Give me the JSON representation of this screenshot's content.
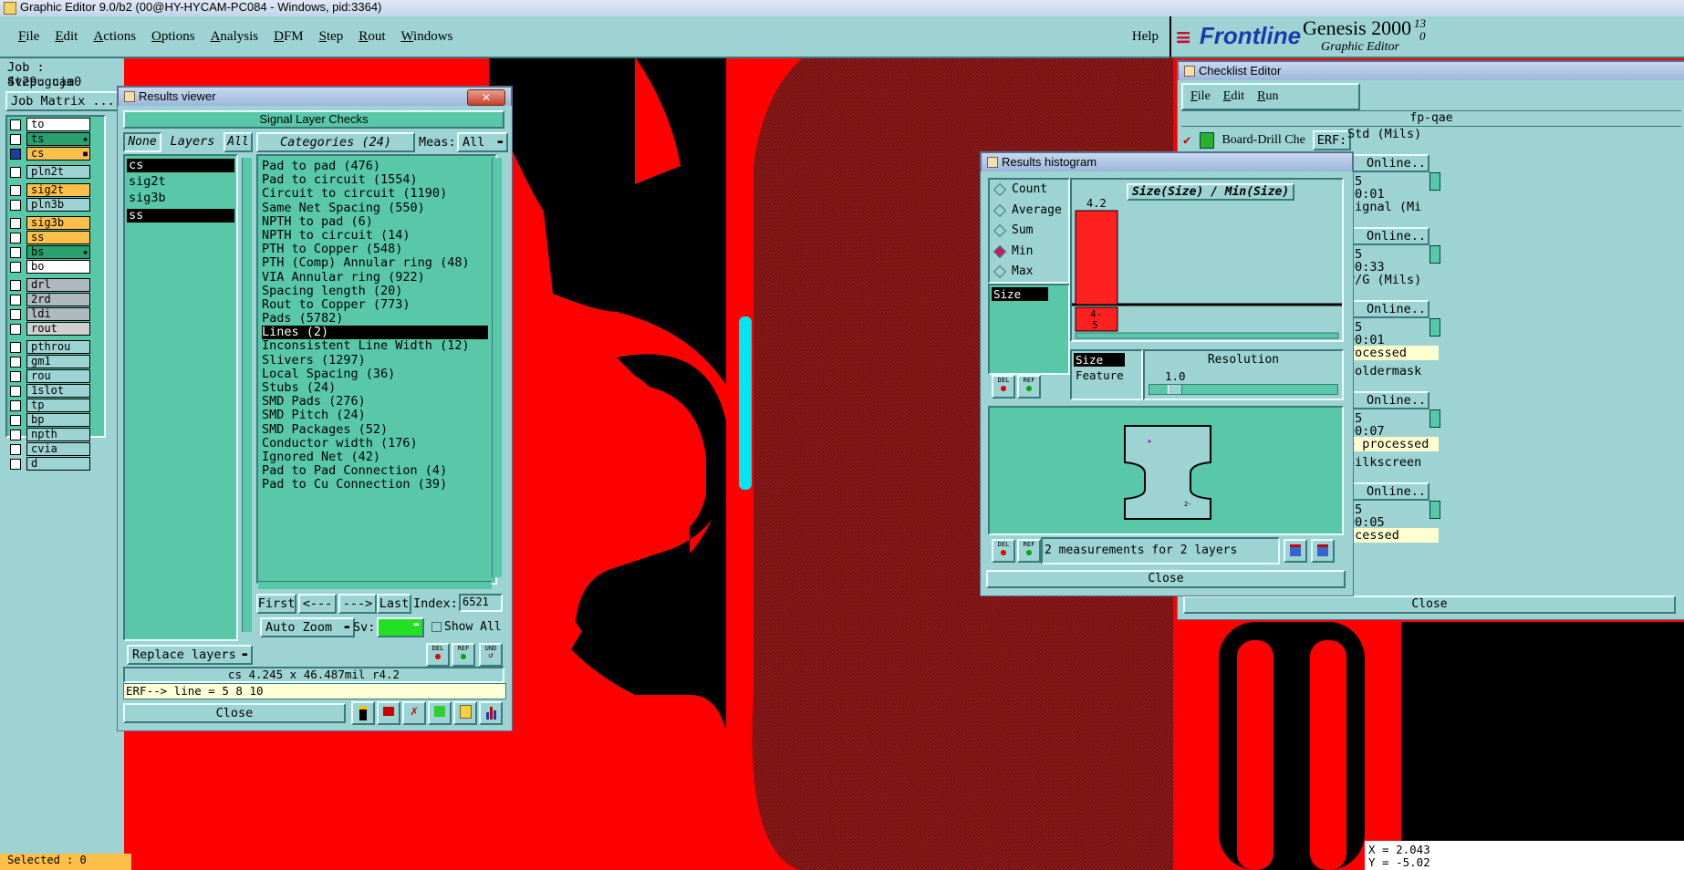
{
  "titlebar": {
    "title": "Graphic Editor 9.0/b2 (00@HY-HYCAM-PC084 - Windows, pid:3364)"
  },
  "menubar": {
    "items": [
      "File",
      "Edit",
      "Actions",
      "Options",
      "Analysis",
      "DFM",
      "Step",
      "Rout",
      "Windows"
    ],
    "help": "Help"
  },
  "brand": {
    "logo": "Frontline",
    "product": "Genesis 2000",
    "subtitle": "Graphic Editor",
    "version_top": "13",
    "version_bottom": "0"
  },
  "job": {
    "job_label": "Job : 4v29uguja0",
    "step_label": "Step: cam",
    "matrix_button": "Job Matrix ..."
  },
  "layers": [
    {
      "name": "to",
      "color": "#ffffff",
      "mark": ""
    },
    {
      "name": "ts",
      "color": "#2aa06e",
      "mark": "◆"
    },
    {
      "name": "cs",
      "color": "#ffc04a",
      "mark": "■"
    },
    {
      "name": "pln2t",
      "color": "#9dd3d3",
      "mark": ""
    },
    {
      "name": "sig2t",
      "color": "#ffc04a",
      "mark": ""
    },
    {
      "name": "pln3b",
      "color": "#9dd3d3",
      "mark": ""
    },
    {
      "name": "sig3b",
      "color": "#ffc04a",
      "mark": ""
    },
    {
      "name": "ss",
      "color": "#ffc04a",
      "mark": ""
    },
    {
      "name": "bs",
      "color": "#2aa06e",
      "mark": "◆"
    },
    {
      "name": "bo",
      "color": "#ffffff",
      "mark": ""
    },
    {
      "name": "drl",
      "color": "#b0b8c0",
      "mark": ""
    },
    {
      "name": "2rd",
      "color": "#b0b8c0",
      "mark": ""
    },
    {
      "name": "ldi",
      "color": "#b0b8c0",
      "mark": ""
    },
    {
      "name": "rout",
      "color": "#d0d0d0",
      "mark": ""
    },
    {
      "name": "pthrou",
      "color": "#9dd3d3",
      "mark": ""
    },
    {
      "name": "gm1",
      "color": "#9dd3d3",
      "mark": ""
    },
    {
      "name": "rou",
      "color": "#9dd3d3",
      "mark": ""
    },
    {
      "name": "1slot",
      "color": "#9dd3d3",
      "mark": ""
    },
    {
      "name": "tp",
      "color": "#9dd3d3",
      "mark": ""
    },
    {
      "name": "bp",
      "color": "#9dd3d3",
      "mark": ""
    },
    {
      "name": "npth",
      "color": "#9dd3d3",
      "mark": ""
    },
    {
      "name": "cvia",
      "color": "#9dd3d3",
      "mark": ""
    },
    {
      "name": "d",
      "color": "#9dd3d3",
      "mark": ""
    }
  ],
  "status_bottom": {
    "selected": "Selected : 0"
  },
  "coords": {
    "x": "X = 2.043",
    "y": "Y = -5.02"
  },
  "results_viewer": {
    "title": "Results viewer",
    "header": "Signal Layer Checks",
    "none_btn": "None",
    "layers_label": "Layers",
    "all_btn": "All",
    "categories_label": "Categories (24)",
    "meas_label": "Meas:",
    "meas_value": "All",
    "layer_list": [
      {
        "name": "cs",
        "selected": true
      },
      {
        "name": "sig2t",
        "selected": false
      },
      {
        "name": "sig3b",
        "selected": false
      },
      {
        "name": "ss",
        "selected": true
      }
    ],
    "categories": [
      {
        "text": "Pad to pad (476)",
        "selected": false
      },
      {
        "text": "Pad to circuit (1554)",
        "selected": false
      },
      {
        "text": "Circuit to circuit (1190)",
        "selected": false
      },
      {
        "text": "Same Net Spacing (550)",
        "selected": false
      },
      {
        "text": "NPTH to pad (6)",
        "selected": false
      },
      {
        "text": "NPTH to circuit (14)",
        "selected": false
      },
      {
        "text": "PTH to Copper (548)",
        "selected": false
      },
      {
        "text": "PTH (Comp) Annular ring (48)",
        "selected": false
      },
      {
        "text": "VIA Annular ring (922)",
        "selected": false
      },
      {
        "text": "Spacing length (20)",
        "selected": false
      },
      {
        "text": "Rout to Copper (773)",
        "selected": false
      },
      {
        "text": "Pads (5782)",
        "selected": false
      },
      {
        "text": "Lines (2)",
        "selected": true
      },
      {
        "text": "Inconsistent Line Width (12)",
        "selected": false
      },
      {
        "text": "Slivers (1297)",
        "selected": false
      },
      {
        "text": "Local Spacing (36)",
        "selected": false
      },
      {
        "text": "Stubs (24)",
        "selected": false
      },
      {
        "text": "SMD Pads (276)",
        "selected": false
      },
      {
        "text": "SMD Pitch (24)",
        "selected": false
      },
      {
        "text": "SMD Packages (52)",
        "selected": false
      },
      {
        "text": "Conductor width (176)",
        "selected": false
      },
      {
        "text": "Ignored Net (42)",
        "selected": false
      },
      {
        "text": "Pad to Pad Connection (4)",
        "selected": false
      },
      {
        "text": "Pad to Cu Connection (39)",
        "selected": false
      }
    ],
    "first_btn": "First",
    "prev_btn": "<---",
    "next_btn": "--->",
    "last_btn": "Last",
    "index_label": "Index:",
    "index_value": "6521",
    "zoom_btn": "Auto Zoom",
    "sv_label": "Sv:",
    "show_all": "Show All",
    "replace_btn": "Replace layers",
    "del_btn": "DEL",
    "ref_btn": "REF",
    "und_btn": "UND",
    "status_line": "cs 4.245 x 46.487mil  r4.2",
    "erf_line": "ERF--> line = 5 8 10",
    "close_btn": "Close"
  },
  "checklist_editor": {
    "title": "Checklist Editor",
    "menu": [
      "File",
      "Edit",
      "Run"
    ],
    "checklist_name": "fp-qae",
    "first_action": "Board-Drill Che",
    "erf_label": "ERF:",
    "right_rows": [
      {
        "text": "Std (Mils)",
        "type": "label"
      },
      {
        "text": "Online..",
        "type": "button"
      },
      {
        "text": "15",
        "type": "label"
      },
      {
        "text": "00:01",
        "type": "label"
      },
      {
        "text": "signal (Mi",
        "type": "label"
      },
      {
        "text": "Online..",
        "type": "button"
      },
      {
        "text": "15",
        "type": "label"
      },
      {
        "text": "00:33",
        "type": "label"
      },
      {
        "text": "P/G (Mils)",
        "type": "label"
      },
      {
        "text": "Online..",
        "type": "button"
      },
      {
        "text": "15",
        "type": "label"
      },
      {
        "text": "00:01",
        "type": "label"
      },
      {
        "text": "rocessed",
        "type": "yellow"
      },
      {
        "text": "Soldermask",
        "type": "label"
      },
      {
        "text": "Online..",
        "type": "button"
      },
      {
        "text": "15",
        "type": "label"
      },
      {
        "text": "00:07",
        "type": "label"
      },
      {
        "text": "e processed",
        "type": "yellow"
      },
      {
        "text": "Silkscreen",
        "type": "label"
      },
      {
        "text": "Online..",
        "type": "button"
      },
      {
        "text": "15",
        "type": "label"
      },
      {
        "text": "00:05",
        "type": "label"
      },
      {
        "text": "ocessed",
        "type": "yellow"
      }
    ],
    "close_btn": "Close"
  },
  "histogram": {
    "title": "Results histogram",
    "options": [
      {
        "label": "Count",
        "selected": false
      },
      {
        "label": "Average",
        "selected": false
      },
      {
        "label": "Sum",
        "selected": false
      },
      {
        "label": "Min",
        "selected": true
      },
      {
        "label": "Max",
        "selected": false
      }
    ],
    "list_item": "Size",
    "chart_title": "Size(Size) / Min(Size)",
    "bar_value_label": "4.2",
    "bin_label_top": "4-",
    "bin_label_bottom": "5",
    "size_item": "Size",
    "feature_item": "Feature",
    "resolution_label": "Resolution",
    "resolution_value": "1.0",
    "measurements_text": "2 measurements for 2 layers",
    "close_btn": "Close",
    "del_btn": "DEL",
    "ref_btn": "REF"
  },
  "chart_data": {
    "type": "bar",
    "title": "Size(Size) / Min(Size)",
    "categories": [
      "4-5"
    ],
    "values": [
      4.2
    ]
  }
}
